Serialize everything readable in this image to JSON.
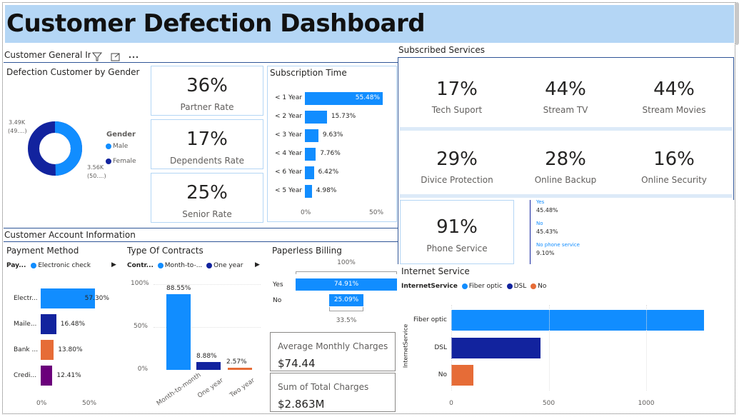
{
  "title": "Customer Defection Dashboard",
  "sections": {
    "general": "Customer General In",
    "subscribed": "Subscribed Services",
    "account": "Customer Account Information"
  },
  "gender": {
    "title": "Defection Customer by Gender",
    "legend_title": "Gender",
    "legend": [
      "Male",
      "Female"
    ],
    "male_label_1": "3.49K",
    "male_label_2": "(49....)",
    "female_label_1": "3.56K",
    "female_label_2": "(50....)",
    "male_value": 3.49,
    "female_value": 3.56
  },
  "kpis": {
    "partner": {
      "value": "36%",
      "label": "Partner Rate"
    },
    "dependents": {
      "value": "17%",
      "label": "Dependents Rate"
    },
    "senior": {
      "value": "25%",
      "label": "Senior Rate"
    }
  },
  "subscription": {
    "title": "Subscription Time",
    "categories": [
      "< 1 Year",
      "< 2 Year",
      "< 3 Year",
      "< 4 Year",
      "< 6 Year",
      "< 5 Year"
    ],
    "values": [
      55.48,
      15.73,
      9.63,
      7.76,
      6.42,
      4.98
    ],
    "labels": [
      "55.48%",
      "15.73%",
      "9.63%",
      "7.76%",
      "6.42%",
      "4.98%"
    ],
    "ticks": [
      "0%",
      "50%"
    ]
  },
  "services": [
    {
      "value": "17%",
      "label": "Tech Suport"
    },
    {
      "value": "44%",
      "label": "Stream TV"
    },
    {
      "value": "44%",
      "label": "Stream Movies"
    },
    {
      "value": "29%",
      "label": "Divice Protection"
    },
    {
      "value": "28%",
      "label": "Online Backup"
    },
    {
      "value": "16%",
      "label": "Online Security"
    }
  ],
  "phone": {
    "value": "91%",
    "label": "Phone Service",
    "breakdown": [
      {
        "name": "Yes",
        "value": "45.48%"
      },
      {
        "name": "No",
        "value": "45.43%"
      },
      {
        "name": "No phone service",
        "value": "9.10%"
      }
    ]
  },
  "payment": {
    "title": "Payment Method",
    "legend_prefix": "Pay...",
    "legend": [
      "Electronic check"
    ],
    "categories": [
      "Electr...",
      "Maile...",
      "Bank ...",
      "Credi..."
    ],
    "values": [
      57.3,
      16.48,
      13.8,
      12.41
    ],
    "labels": [
      "57.30%",
      "16.48%",
      "13.80%",
      "12.41%"
    ],
    "ticks": [
      "0%",
      "50%"
    ]
  },
  "contracts": {
    "title": "Type Of Contracts",
    "legend_prefix": "Contr...",
    "legend": [
      "Month-to-...",
      "One year"
    ],
    "categories": [
      "Month-to-month",
      "One year",
      "Two year"
    ],
    "values": [
      88.55,
      8.88,
      2.57
    ],
    "labels": [
      "88.55%",
      "8.88%",
      "2.57%"
    ],
    "yticks": [
      "100%",
      "50%",
      "0%"
    ]
  },
  "paperless": {
    "title": "Paperless Billing",
    "top": "100%",
    "categories": [
      "Yes",
      "No"
    ],
    "values": [
      74.91,
      25.09
    ],
    "labels": [
      "74.91%",
      "25.09%"
    ],
    "bottom": "33.5%"
  },
  "charges": {
    "avg_label": "Average Monthly Charges",
    "avg_value": "$74.44",
    "sum_label": "Sum of Total Charges",
    "sum_value": "$2.863M"
  },
  "internet": {
    "title": "Internet Service",
    "legend_prefix": "InternetService",
    "legend": [
      "Fiber optic",
      "DSL",
      "No"
    ],
    "categories": [
      "Fiber optic",
      "DSL",
      "No"
    ],
    "values": [
      1297,
      459,
      113
    ],
    "yaxis": "InternetService",
    "ticks": [
      "0",
      "500",
      "1000"
    ]
  },
  "colors": {
    "blue": "#118dff",
    "navy": "#12239e",
    "orange": "#e66c37",
    "purple": "#6b007b",
    "banner": "#b4d6f5"
  }
}
